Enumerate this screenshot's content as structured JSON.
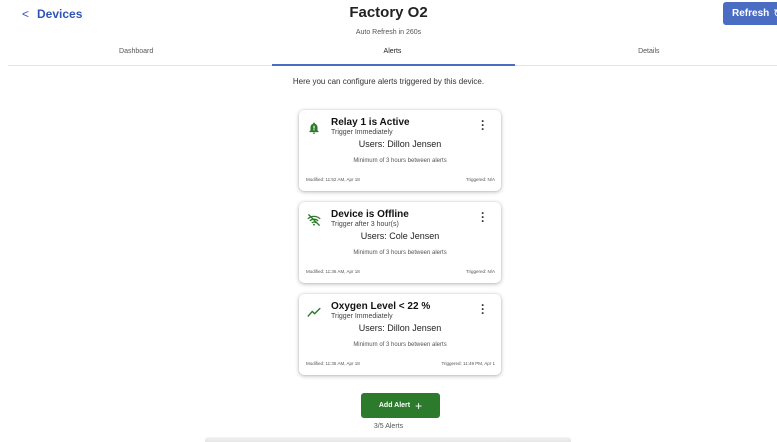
{
  "header": {
    "back_label": "Devices",
    "title": "Factory O2",
    "subtitle": "Auto Refresh in 260s",
    "refresh_label": "Refresh"
  },
  "tabs": [
    {
      "label": "Dashboard",
      "active": false
    },
    {
      "label": "Alerts",
      "active": true
    },
    {
      "label": "Details",
      "active": false
    }
  ],
  "intro": "Here you can configure alerts triggered by this device.",
  "alerts": [
    {
      "icon": "bell-active-icon",
      "title": "Relay 1 is Active",
      "trigger": "Trigger Immediately",
      "users": "Users: Dillon Jensen",
      "minimum": "Minimum of 3 hours between alerts",
      "modified": "Modified: 11:52 AM, Apr 18",
      "triggered": "Triggered: N/A"
    },
    {
      "icon": "wifi-off-icon",
      "title": "Device is Offline",
      "trigger": "Trigger after 3 hour(s)",
      "users": "Users: Cole Jensen",
      "minimum": "Minimum of 3 hours between alerts",
      "modified": "Modified: 11:36 AM, Apr 18",
      "triggered": "Triggered: N/A"
    },
    {
      "icon": "trending-up-icon",
      "title": "Oxygen Level < 22 %",
      "trigger": "Trigger Immediately",
      "users": "Users: Dillon Jensen",
      "minimum": "Minimum of 3 hours between alerts",
      "modified": "Modified: 11:35 AM, Apr 18",
      "triggered": "Triggered: 11:49 PM, Apr 1"
    }
  ],
  "add_alert_label": "Add Alert",
  "alert_count": "3/5 Alerts",
  "colors": {
    "accent_blue": "#4a6cc2",
    "link_blue": "#2f55b5",
    "icon_green": "#2c7a2c",
    "add_button_green": "#2c7a2c"
  }
}
